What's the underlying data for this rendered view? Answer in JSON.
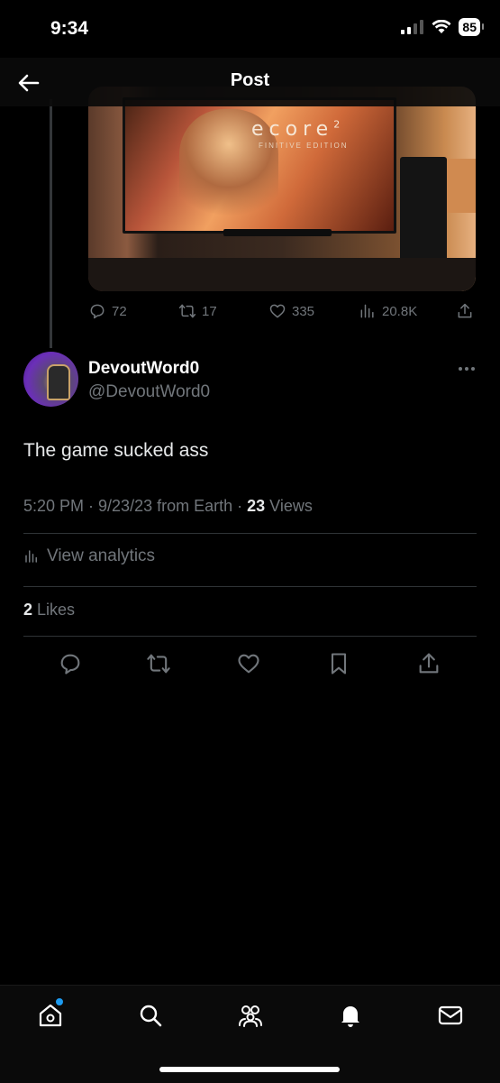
{
  "status_bar": {
    "time": "9:34",
    "battery": "85"
  },
  "header": {
    "title": "Post"
  },
  "parent_post": {
    "media": {
      "logo": "ecore",
      "logo_sup": "2",
      "sub": "FINITIVE EDITION"
    },
    "stats": {
      "replies": "72",
      "reposts": "17",
      "likes": "335",
      "views": "20.8K"
    }
  },
  "post": {
    "display_name": "DevoutWord0",
    "handle": "@DevoutWord0",
    "text": "The game sucked ass",
    "meta_prefix": "5:20 PM · 9/23/23 from Earth · ",
    "views_count": "23",
    "views_label": " Views",
    "analytics_label": "View analytics",
    "likes_count": "2",
    "likes_label": " Likes"
  },
  "colors": {
    "accent": "#1d9bf0",
    "muted": "#71767b",
    "text": "#e7e9ea"
  },
  "icons": {
    "header": [
      "back-arrow-icon"
    ],
    "post_actions": [
      "reply-icon",
      "repost-icon",
      "like-icon",
      "bookmark-icon",
      "share-icon"
    ],
    "tabbar": [
      "home-icon",
      "search-icon",
      "communities-icon",
      "notifications-icon",
      "messages-icon"
    ]
  }
}
